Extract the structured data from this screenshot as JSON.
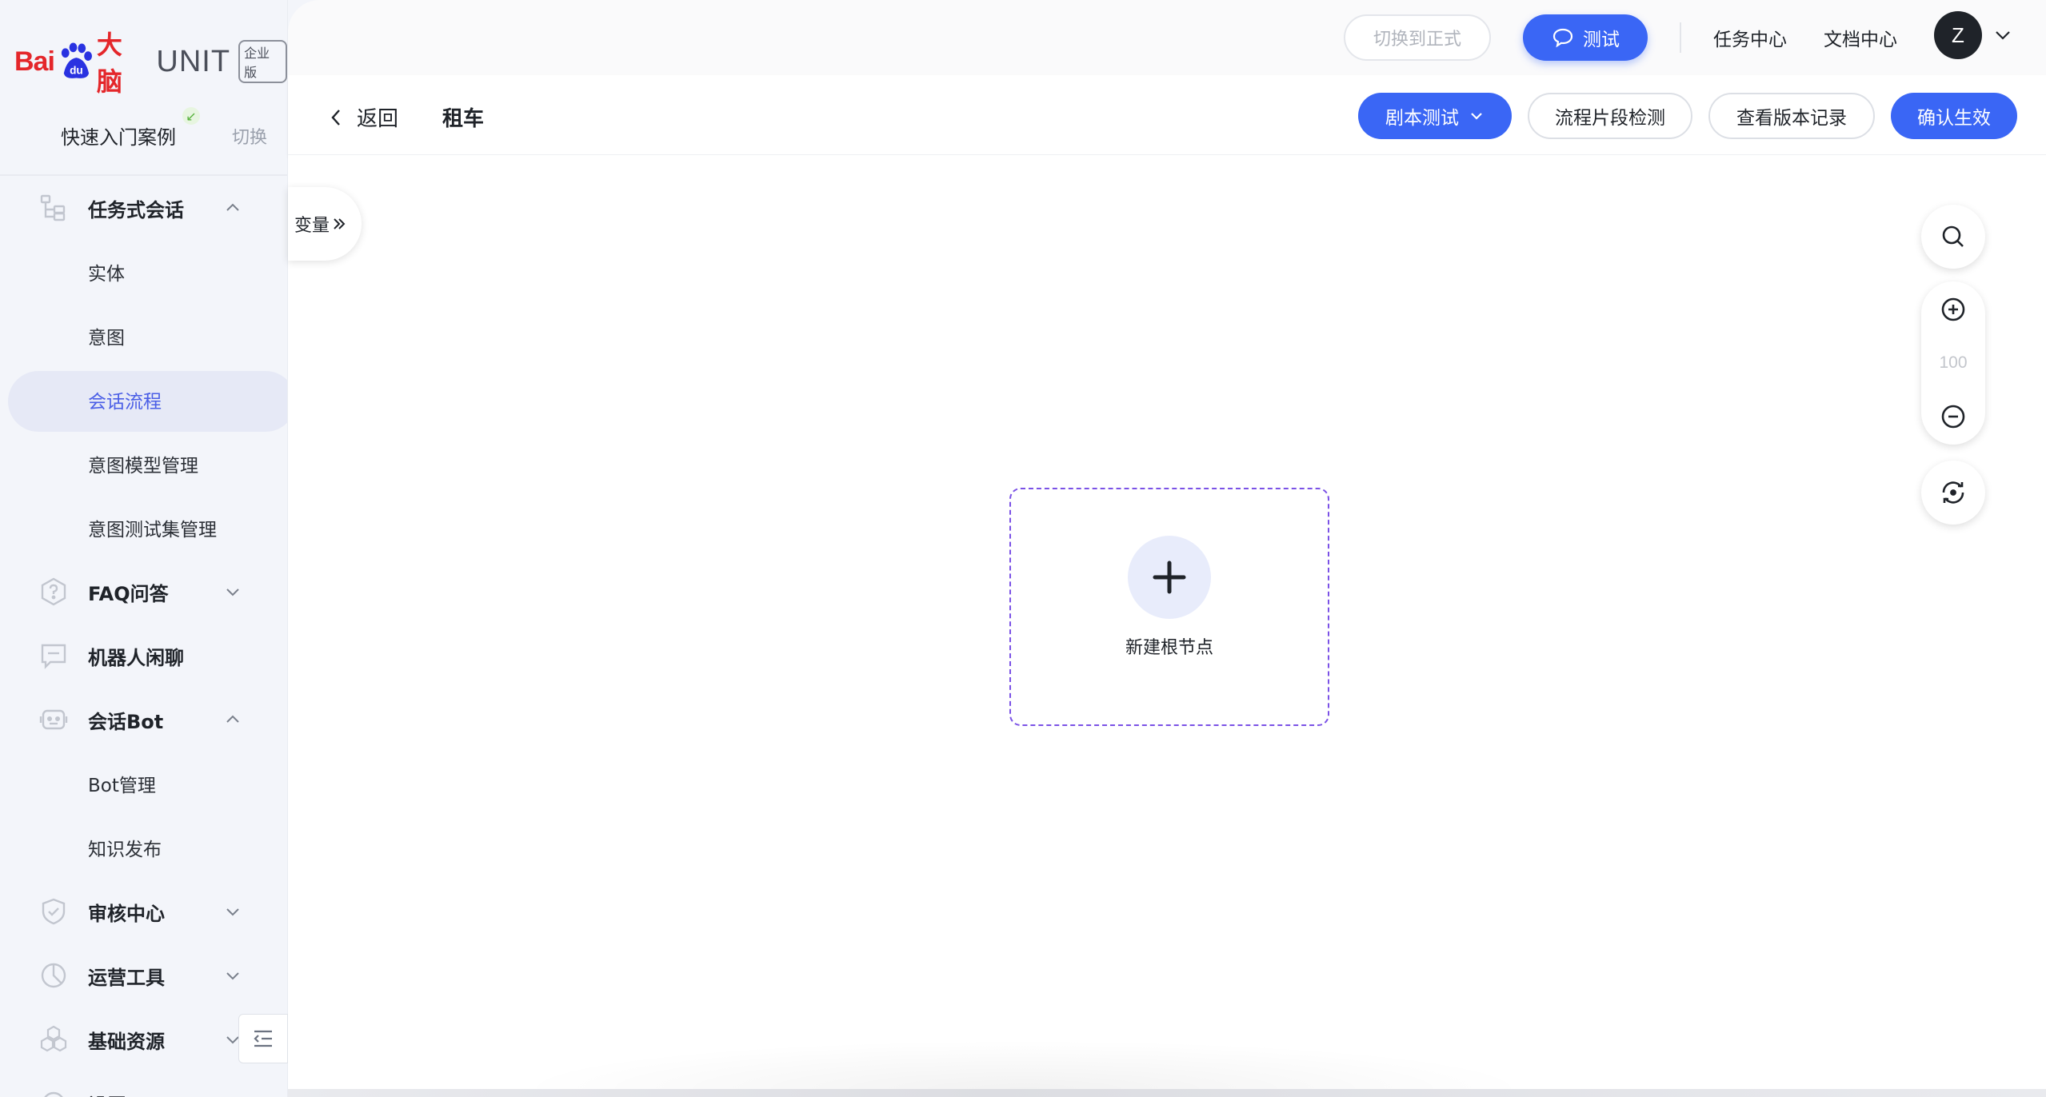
{
  "brand": {
    "bai": "Bai",
    "du": "du",
    "danao": "大脑",
    "unit": "UNIT",
    "edition": "企业版",
    "brand_color": "#e4262a"
  },
  "sidebar": {
    "quick_label": "快速入门案例",
    "quick_badge": "↙",
    "switch_label": "切换",
    "menu": [
      {
        "type": "group",
        "label": "任务式会话",
        "icon": "tree-icon",
        "expanded": true
      },
      {
        "type": "sub",
        "label": "实体"
      },
      {
        "type": "sub",
        "label": "意图"
      },
      {
        "type": "sub",
        "label": "会话流程",
        "active": true
      },
      {
        "type": "sub",
        "label": "意图模型管理"
      },
      {
        "type": "sub",
        "label": "意图测试集管理"
      },
      {
        "type": "group",
        "label": "FAQ问答",
        "icon": "question-hexagon-icon",
        "expanded": false
      },
      {
        "type": "group",
        "label": "机器人闲聊",
        "icon": "chat-box-icon"
      },
      {
        "type": "group",
        "label": "会话Bot",
        "icon": "robot-icon",
        "expanded": true
      },
      {
        "type": "sub",
        "label": "Bot管理"
      },
      {
        "type": "sub",
        "label": "知识发布"
      },
      {
        "type": "group",
        "label": "审核中心",
        "icon": "shield-check-icon",
        "expanded": false
      },
      {
        "type": "group",
        "label": "运营工具",
        "icon": "pie-chart-icon",
        "expanded": false
      },
      {
        "type": "group",
        "label": "基础资源",
        "icon": "hexagons-icon",
        "expanded": false
      },
      {
        "type": "group",
        "label": "设置",
        "icon": "settings-icon",
        "expanded": false
      }
    ]
  },
  "topbar": {
    "switch_formal": "切换到正式",
    "test": "测试",
    "task_center": "任务中心",
    "doc_center": "文档中心",
    "avatar_letter": "Z",
    "accent_color": "#3a66f5"
  },
  "header": {
    "back": "返回",
    "title": "租车",
    "script_test": "剧本测试",
    "flow_check": "流程片段检测",
    "version_history": "查看版本记录",
    "confirm": "确认生效"
  },
  "canvas": {
    "variables_tab": "变量",
    "zoom_level": "100",
    "root_node_label": "新建根节点",
    "node_border_color": "#7b52e6"
  }
}
